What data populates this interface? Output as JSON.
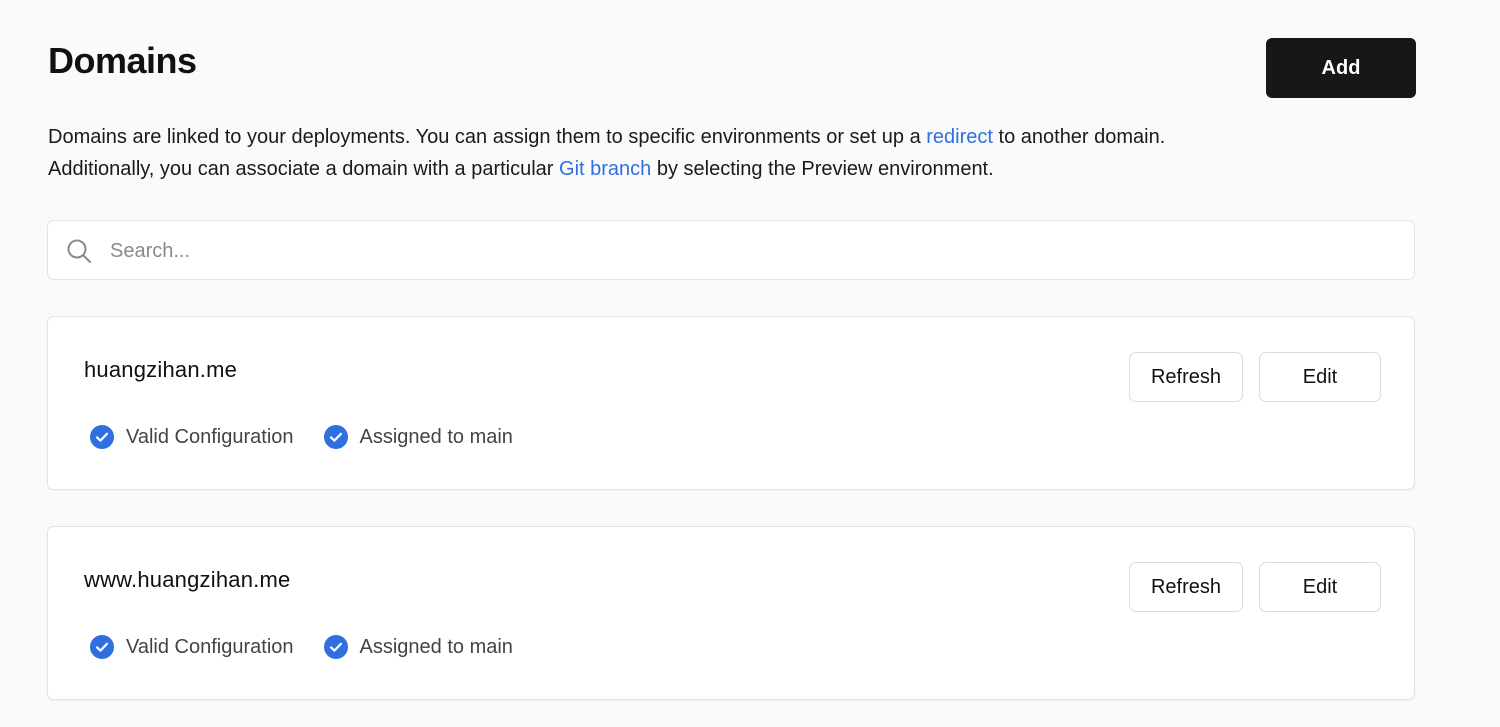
{
  "header": {
    "title": "Domains",
    "add_label": "Add"
  },
  "description": {
    "line1_before": "Domains are linked to your deployments. You can assign them to specific environments or set up a ",
    "line1_link": "redirect",
    "line1_after": " to another domain.",
    "line2_before": "Additionally, you can associate a domain with a particular ",
    "line2_link": "Git branch",
    "line2_after": " by selecting the Preview environment."
  },
  "search": {
    "placeholder": "Search...",
    "value": ""
  },
  "domains": [
    {
      "name": "huangzihan.me",
      "refresh_label": "Refresh",
      "edit_label": "Edit",
      "statuses": [
        {
          "label": "Valid Configuration",
          "icon": "check-circle-icon"
        },
        {
          "label": "Assigned to main",
          "icon": "check-circle-icon"
        }
      ]
    },
    {
      "name": "www.huangzihan.me",
      "refresh_label": "Refresh",
      "edit_label": "Edit",
      "statuses": [
        {
          "label": "Valid Configuration",
          "icon": "check-circle-icon"
        },
        {
          "label": "Assigned to main",
          "icon": "check-circle-icon"
        }
      ]
    }
  ],
  "colors": {
    "background": "#fafafa",
    "primary_button": "#171717",
    "link": "#2f6fe0",
    "check": "#2f6fe0",
    "card_border": "#e3e3e3"
  }
}
